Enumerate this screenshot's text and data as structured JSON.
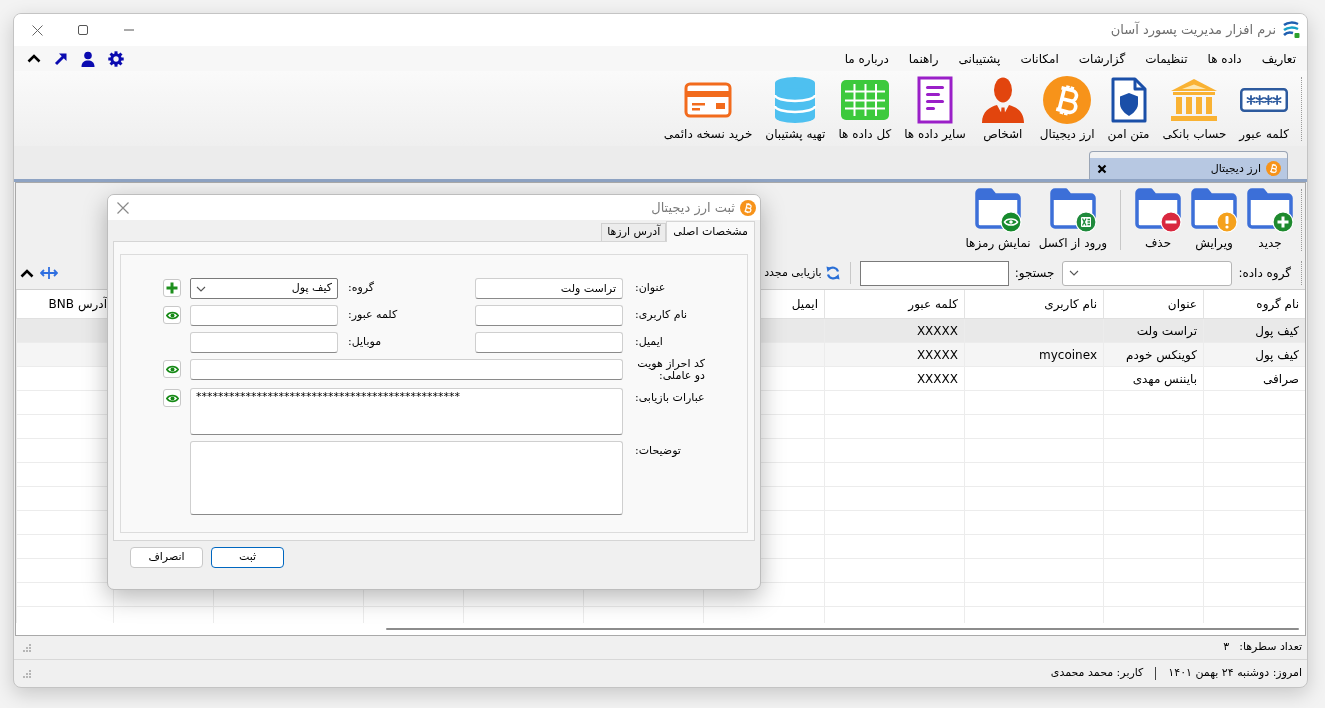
{
  "window": {
    "title": "نرم افزار مدیریت پسورد آسان"
  },
  "menu": [
    "تعاریف",
    "داده ها",
    "تنظیمات",
    "گزارشات",
    "امکانات",
    "پشتیبانی",
    "راهنما",
    "درباره ما"
  ],
  "ribbon": [
    {
      "kind": "password",
      "label": "کلمه عبور"
    },
    {
      "kind": "bank",
      "label": "حساب بانکی"
    },
    {
      "kind": "note",
      "label": "متن امن"
    },
    {
      "kind": "crypto",
      "label": "ارز دیجیتال"
    },
    {
      "kind": "people",
      "label": "اشخاص"
    },
    {
      "kind": "other",
      "label": "سایر داده ها"
    },
    {
      "kind": "all",
      "label": "کل داده ها"
    },
    {
      "kind": "backup",
      "label": "تهیه پشتیبان"
    },
    {
      "kind": "purchase",
      "label": "خرید نسخه دائمی"
    }
  ],
  "document_tabs": [
    {
      "label": "ارز دیجیتال",
      "selected": true
    }
  ],
  "toolbar": [
    {
      "kind": "new",
      "label": "جدید",
      "separated": false
    },
    {
      "kind": "edit",
      "label": "ویرایش",
      "separated": false
    },
    {
      "kind": "delete",
      "label": "حذف",
      "separated": false
    },
    {
      "kind": "import",
      "label": "ورود از اکسل",
      "separated": true
    },
    {
      "kind": "reveal",
      "label": "نمایش رمزها",
      "separated": false
    }
  ],
  "filter": {
    "group_label": "گروه داده:",
    "search_label": "جستجو:",
    "refresh_label": "بازیابی مجدد"
  },
  "table": {
    "columns": [
      "نام گروه",
      "عنوان",
      "نام کاربری",
      "کلمه عبور",
      "ایمیل",
      "آدرس BNB"
    ],
    "rows": [
      {
        "group": "کیف پول",
        "title": "تراست ولت",
        "password": "XXXXX",
        "selected": true
      },
      {
        "group": "کیف پول",
        "title": "کوینکس خودم",
        "username": "mycoinex",
        "password": "XXXXX",
        "selected": false
      },
      {
        "group": "صرافی",
        "title": "بایننس مهدی",
        "password": "XXXXX",
        "selected": false
      }
    ]
  },
  "row_count": {
    "label": "تعداد سطرها:",
    "value": "۳"
  },
  "status_bar": {
    "date": "امروز: دوشنبه ۲۴ بهمن ۱۴۰۱",
    "user": "کاربر: محمد محمدی"
  },
  "dialog": {
    "title": "ثبت ارز دیجیتال",
    "tabs": [
      {
        "label": "مشخصات اصلی",
        "selected": true
      },
      {
        "label": "آدرس ارزها",
        "selected": false
      }
    ],
    "fields": [
      {
        "kind": "text",
        "label": "عنوان:",
        "value": "تراست ولت",
        "add_button": false,
        "reveal_button": false
      },
      {
        "kind": "select",
        "label": "گروه:",
        "value": "کیف پول",
        "add_button": true,
        "reveal_button": false
      },
      {
        "kind": "text",
        "label": "نام کاربری:",
        "add_button": false,
        "reveal_button": false
      },
      {
        "kind": "text",
        "label": "کلمه عبور:",
        "add_button": false,
        "reveal_button": true
      },
      {
        "kind": "text",
        "label": "ایمیل:",
        "add_button": false,
        "reveal_button": false
      },
      {
        "kind": "text",
        "label": "موبایل:",
        "add_button": false,
        "reveal_button": false
      },
      {
        "kind": "wide",
        "label": "کد احراز هویت دو عاملی:",
        "add_button": false,
        "reveal_button": true
      },
      {
        "kind": "memo",
        "label": "عبارات بازیابی:",
        "value": "************************************************",
        "add_button": false,
        "reveal_button": true
      },
      {
        "kind": "notes",
        "label": "توضیحات:",
        "add_button": false,
        "reveal_button": false
      }
    ],
    "buttons": [
      {
        "label": "ثبت",
        "focused": true
      },
      {
        "label": "انصراف",
        "focused": false
      }
    ]
  }
}
